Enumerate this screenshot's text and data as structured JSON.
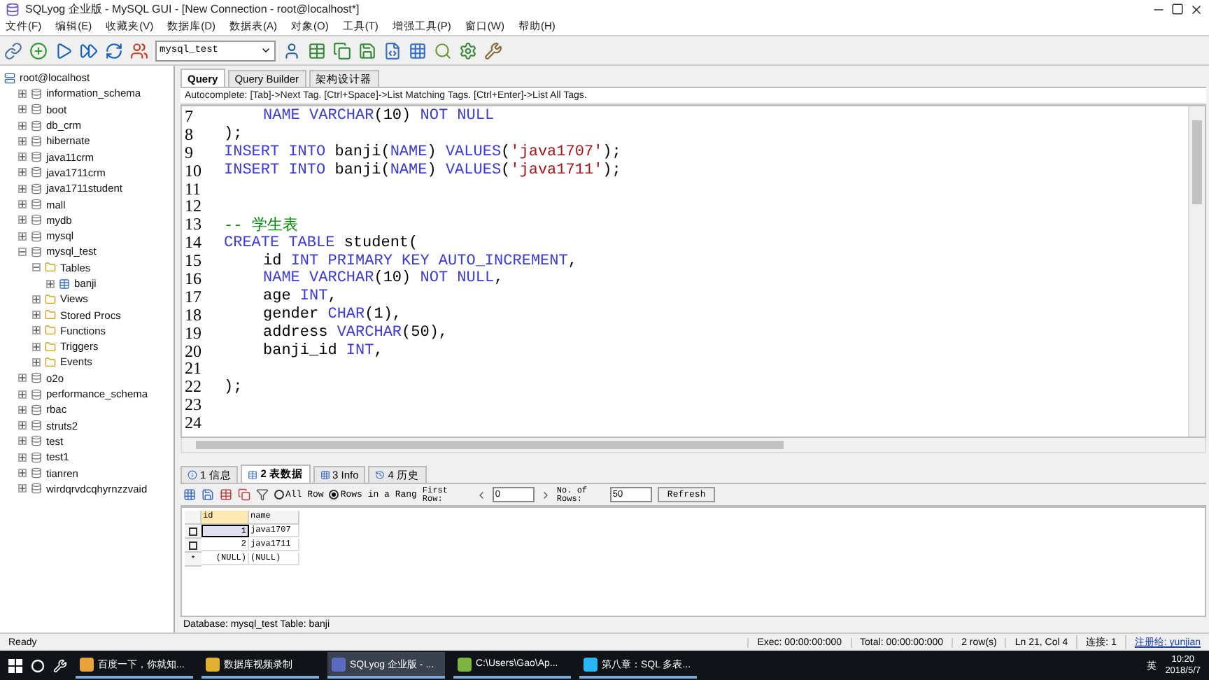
{
  "window": {
    "title": "SQLyog 企业版 - MySQL GUI - [New Connection - root@localhost*]"
  },
  "menu": [
    "文件(F)",
    "编辑(E)",
    "收藏夹(V)",
    "数据库(D)",
    "数据表(A)",
    "对象(O)",
    "工具(T)",
    "增强工具(P)",
    "窗口(W)",
    "帮助(H)"
  ],
  "toolbar": {
    "database_select": "mysql_test"
  },
  "tree": {
    "label": "root@localhost",
    "kind": "server",
    "children": [
      {
        "label": "information_schema",
        "kind": "db",
        "expanded": false
      },
      {
        "label": "boot",
        "kind": "db",
        "expanded": false
      },
      {
        "label": "db_crm",
        "kind": "db",
        "expanded": false
      },
      {
        "label": "hibernate",
        "kind": "db",
        "expanded": false
      },
      {
        "label": "java11crm",
        "kind": "db",
        "expanded": false
      },
      {
        "label": "java1711crm",
        "kind": "db",
        "expanded": false
      },
      {
        "label": "java1711student",
        "kind": "db",
        "expanded": false
      },
      {
        "label": "mall",
        "kind": "db",
        "expanded": false
      },
      {
        "label": "mydb",
        "kind": "db",
        "expanded": false
      },
      {
        "label": "mysql",
        "kind": "db",
        "expanded": false
      },
      {
        "label": "mysql_test",
        "kind": "db",
        "expanded": true,
        "children": [
          {
            "label": "Tables",
            "kind": "folder",
            "expanded": true,
            "children": [
              {
                "label": "banji",
                "kind": "table",
                "expanded": false
              }
            ]
          },
          {
            "label": "Views",
            "kind": "folder",
            "expanded": false
          },
          {
            "label": "Stored Procs",
            "kind": "folder",
            "expanded": false
          },
          {
            "label": "Functions",
            "kind": "folder",
            "expanded": false
          },
          {
            "label": "Triggers",
            "kind": "folder",
            "expanded": false
          },
          {
            "label": "Events",
            "kind": "folder",
            "expanded": false
          }
        ]
      },
      {
        "label": "o2o",
        "kind": "db",
        "expanded": false
      },
      {
        "label": "performance_schema",
        "kind": "db",
        "expanded": false
      },
      {
        "label": "rbac",
        "kind": "db",
        "expanded": false
      },
      {
        "label": "struts2",
        "kind": "db",
        "expanded": false
      },
      {
        "label": "test",
        "kind": "db",
        "expanded": false
      },
      {
        "label": "test1",
        "kind": "db",
        "expanded": false
      },
      {
        "label": "tianren",
        "kind": "db",
        "expanded": false
      },
      {
        "label": "wirdqrvdcqhyrnzzvaid",
        "kind": "db",
        "expanded": false
      }
    ]
  },
  "editor_tabs": [
    {
      "label": "Query",
      "selected": true
    },
    {
      "label": "Query Builder",
      "selected": false
    },
    {
      "label": "架构设计器",
      "selected": false
    }
  ],
  "autocomplete_hint": "Autocomplete: [Tab]->Next Tag. [Ctrl+Space]->List Matching Tags. [Ctrl+Enter]->List All Tags.",
  "code_lines": [
    {
      "no": "7",
      "indent": true,
      "tokens": [
        {
          "t": "NAME ",
          "kind": "kw"
        },
        {
          "t": "VARCHAR",
          "kind": "kw"
        },
        {
          "t": "(10) ",
          "kind": "plain"
        },
        {
          "t": "NOT NULL",
          "kind": "kw"
        }
      ]
    },
    {
      "no": "8",
      "indent": false,
      "tokens": [
        {
          "t": ");",
          "kind": "plain"
        }
      ]
    },
    {
      "no": "9",
      "indent": false,
      "tokens": [
        {
          "t": "INSERT INTO ",
          "kind": "kw"
        },
        {
          "t": "banji(",
          "kind": "plain"
        },
        {
          "t": "NAME",
          "kind": "kw"
        },
        {
          "t": ") ",
          "kind": "plain"
        },
        {
          "t": "VALUES",
          "kind": "kw"
        },
        {
          "t": "(",
          "kind": "plain"
        },
        {
          "t": "'java1707'",
          "kind": "str"
        },
        {
          "t": ");",
          "kind": "plain"
        }
      ]
    },
    {
      "no": "10",
      "indent": false,
      "tokens": [
        {
          "t": "INSERT INTO ",
          "kind": "kw"
        },
        {
          "t": "banji(",
          "kind": "plain"
        },
        {
          "t": "NAME",
          "kind": "kw"
        },
        {
          "t": ") ",
          "kind": "plain"
        },
        {
          "t": "VALUES",
          "kind": "kw"
        },
        {
          "t": "(",
          "kind": "plain"
        },
        {
          "t": "'java1711'",
          "kind": "str"
        },
        {
          "t": ");",
          "kind": "plain"
        }
      ]
    },
    {
      "no": "11"
    },
    {
      "no": "12"
    },
    {
      "no": "13",
      "indent": false,
      "tokens": [
        {
          "t": "-- 学生表",
          "kind": "cm"
        }
      ]
    },
    {
      "no": "14",
      "indent": false,
      "tokens": [
        {
          "t": "CREATE TABLE ",
          "kind": "kw"
        },
        {
          "t": "student(",
          "kind": "plain"
        }
      ]
    },
    {
      "no": "15",
      "indent": true,
      "tokens": [
        {
          "t": "id ",
          "kind": "plain"
        },
        {
          "t": "INT PRIMARY KEY AUTO_INCREMENT",
          "kind": "kw"
        },
        {
          "t": ",",
          "kind": "plain"
        }
      ]
    },
    {
      "no": "16",
      "indent": true,
      "tokens": [
        {
          "t": "NAME ",
          "kind": "kw"
        },
        {
          "t": "VARCHAR",
          "kind": "kw"
        },
        {
          "t": "(10) ",
          "kind": "plain"
        },
        {
          "t": "NOT NULL",
          "kind": "kw"
        },
        {
          "t": ",",
          "kind": "plain"
        }
      ]
    },
    {
      "no": "17",
      "indent": true,
      "tokens": [
        {
          "t": "age ",
          "kind": "plain"
        },
        {
          "t": "INT",
          "kind": "kw"
        },
        {
          "t": ",",
          "kind": "plain"
        }
      ]
    },
    {
      "no": "18",
      "indent": true,
      "tokens": [
        {
          "t": "gender ",
          "kind": "plain"
        },
        {
          "t": "CHAR",
          "kind": "kw"
        },
        {
          "t": "(1),",
          "kind": "plain"
        }
      ]
    },
    {
      "no": "19",
      "indent": true,
      "tokens": [
        {
          "t": "address ",
          "kind": "plain"
        },
        {
          "t": "VARCHAR",
          "kind": "kw"
        },
        {
          "t": "(50),",
          "kind": "plain"
        }
      ]
    },
    {
      "no": "20",
      "indent": true,
      "tokens": [
        {
          "t": "banji_id ",
          "kind": "plain"
        },
        {
          "t": "INT",
          "kind": "kw"
        },
        {
          "t": ",",
          "kind": "plain"
        }
      ]
    },
    {
      "no": "21"
    },
    {
      "no": "22",
      "indent": false,
      "tokens": [
        {
          "t": ");",
          "kind": "plain"
        }
      ]
    },
    {
      "no": "23"
    },
    {
      "no": "24"
    }
  ],
  "result_tabs": [
    {
      "label": "1 信息",
      "selected": false
    },
    {
      "label": "2 表数据",
      "selected": true
    },
    {
      "label": "3 Info",
      "selected": false
    },
    {
      "label": "4 历史",
      "selected": false
    }
  ],
  "result_toolbar": {
    "radios": [
      {
        "label": "All Row",
        "selected": false
      },
      {
        "label": "Rows in a Rang",
        "selected": true
      }
    ],
    "first_row_label": "First Row:",
    "first_row": "0",
    "rows_label": "No. of Rows:",
    "rows": "50",
    "refresh": "Refresh"
  },
  "grid": {
    "columns": [
      "id",
      "name"
    ],
    "rows": [
      {
        "kind": "data",
        "checked": false,
        "cells": [
          "1",
          "java1707"
        ],
        "selected": true
      },
      {
        "kind": "data",
        "checked": false,
        "cells": [
          "2",
          "java1711"
        ],
        "selected": false
      },
      {
        "kind": "new",
        "marker": "*",
        "cells": [
          "(NULL)",
          "(NULL)"
        ],
        "selected": false
      }
    ]
  },
  "info_line": "Database: mysql_test Table: banji",
  "status_bar": [
    "Ready",
    "Exec: 00:00:00:000",
    "Total: 00:00:00:000",
    "2 row(s)",
    "Ln 21, Col 4",
    "连接: 1",
    "注册给: yunjian"
  ],
  "taskbar": {
    "apps": [
      {
        "label": "百度一下，你就知...",
        "selected": false
      },
      {
        "label": "数据库视频录制",
        "selected": false
      },
      {
        "label": "SQLyog 企业版 - ...",
        "selected": true
      },
      {
        "label": "C:\\Users\\Gao\\Ap...",
        "selected": false
      },
      {
        "label": "第八章：SQL 多表...",
        "selected": false
      }
    ],
    "ime": "英",
    "time": "10:20",
    "date": "2018/5/7"
  }
}
